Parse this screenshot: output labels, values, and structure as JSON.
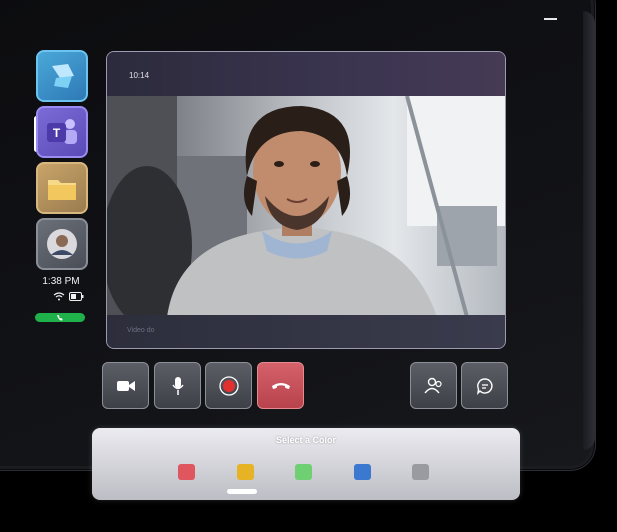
{
  "status": {
    "time": "1:38 PM",
    "icons": [
      "wifi-icon",
      "battery-icon"
    ]
  },
  "sidebar": {
    "apps": [
      {
        "name": "azure-icon",
        "active": false
      },
      {
        "name": "teams-icon",
        "active": true
      },
      {
        "name": "folder-icon",
        "active": false
      },
      {
        "name": "profile-avatar",
        "active": false
      }
    ],
    "call_indicator_icon": "phone-icon"
  },
  "call_window": {
    "time_label": "10:14",
    "bottom_hint": "Video do"
  },
  "controls": [
    {
      "name": "camera-button",
      "icon": "camera-icon"
    },
    {
      "name": "mic-button",
      "icon": "mic-icon"
    },
    {
      "name": "record-button",
      "icon": "record-icon"
    },
    {
      "name": "end-call-button",
      "icon": "hangup-icon"
    },
    {
      "name": "participants-button",
      "icon": "people-icon"
    },
    {
      "name": "chat-button",
      "icon": "chat-icon"
    }
  ],
  "palette": {
    "title": "Select a Color",
    "swatches": [
      {
        "name": "red",
        "color": "#e0565f"
      },
      {
        "name": "yellow",
        "color": "#e6b325"
      },
      {
        "name": "green",
        "color": "#6fcf73"
      },
      {
        "name": "blue",
        "color": "#3b78cf"
      },
      {
        "name": "gray",
        "color": "#9a9ba1"
      }
    ]
  },
  "colors": {
    "call_active": "#1fb14a",
    "end_call": "#c9505a",
    "record": "#e0302f"
  }
}
